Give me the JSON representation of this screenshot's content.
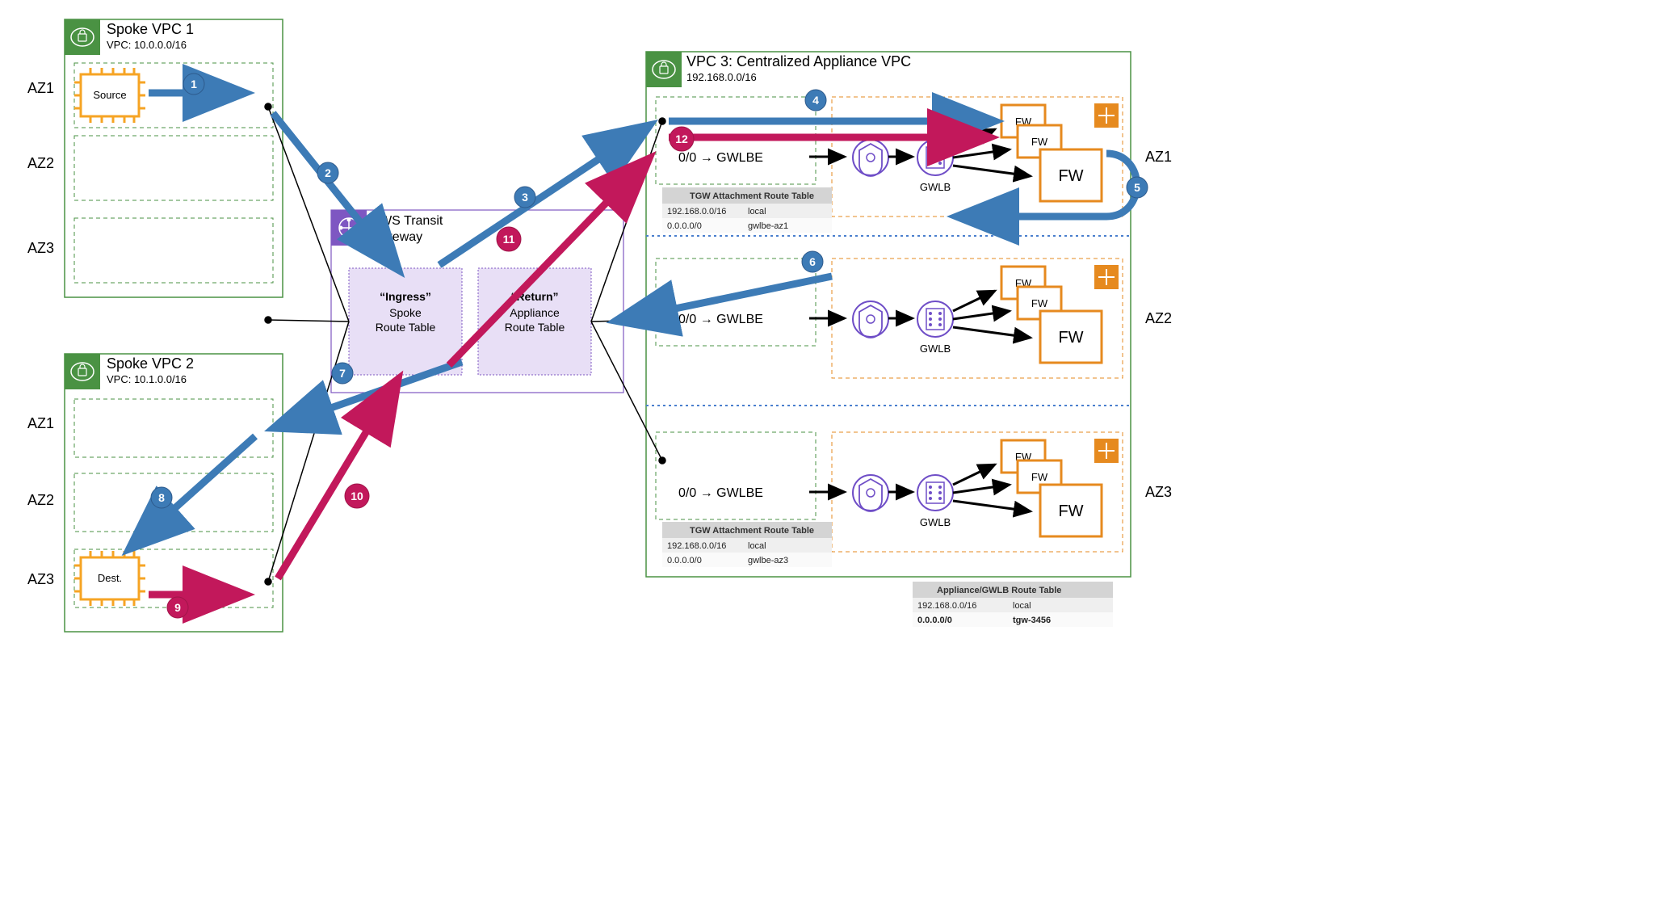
{
  "vpc1": {
    "title": "Spoke VPC 1",
    "cidr": "VPC: 10.0.0.0/16",
    "source": "Source"
  },
  "vpc2": {
    "title": "Spoke VPC 2",
    "cidr": "VPC: 10.1.0.0/16",
    "dest": "Dest."
  },
  "vpc3": {
    "title": "VPC 3: Centralized  Appliance VPC",
    "cidr": "192.168.0.0/16"
  },
  "az_left": {
    "az1": "AZ1",
    "az2": "AZ2",
    "az3": "AZ3"
  },
  "az_right": {
    "az1": "AZ1",
    "az2": "AZ2",
    "az3": "AZ3"
  },
  "tgw": {
    "title_l1": "AWS Transit",
    "title_l2": "Gateway",
    "ingress_l1": "“Ingress”",
    "ingress_l2": "Spoke",
    "ingress_l3": "Route Table",
    "return_l1": "“Return”",
    "return_l2": "Appliance",
    "return_l3": "Route Table"
  },
  "route_lbl": "0/0 → GWLBE",
  "gwlb": "GWLB",
  "fw": "FW",
  "rt1": {
    "title": "TGW Attachment Route Table",
    "r1c1": "192.168.0.0/16",
    "r1c2": "local",
    "r2c1": "0.0.0.0/0",
    "r2c2": "gwlbe-az1"
  },
  "rt2": {
    "title": "TGW Attachment Route Table",
    "r1c1": "192.168.0.0/16",
    "r1c2": "local",
    "r2c1": "0.0.0.0/0",
    "r2c2": "gwlbe-az3"
  },
  "rt3": {
    "title": "Appliance/GWLB Route Table",
    "r1c1": "192.168.0.0/16",
    "r1c2": "local",
    "r2c1": "0.0.0.0/0",
    "r2c2": "tgw-3456"
  },
  "steps": {
    "1": "1",
    "2": "2",
    "3": "3",
    "4": "4",
    "5": "5",
    "6": "6",
    "7": "7",
    "8": "8",
    "9": "9",
    "10": "10",
    "11": "11",
    "12": "12"
  }
}
